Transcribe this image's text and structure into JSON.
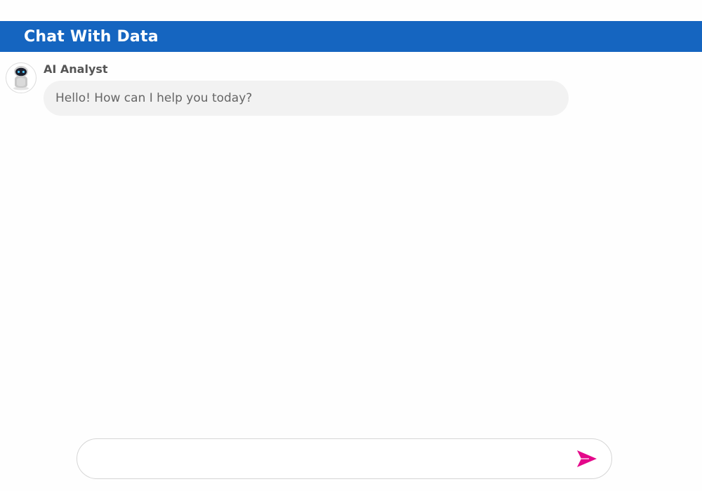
{
  "header": {
    "title": "Chat With Data"
  },
  "messages": [
    {
      "sender": "AI Analyst",
      "text": "Hello! How can I help you today?",
      "avatar_icon": "robot-icon"
    }
  ],
  "composer": {
    "placeholder": "",
    "value": "",
    "send_icon": "send-icon"
  },
  "colors": {
    "accent": "#1565c0",
    "send": "#e4088a",
    "bubble": "#f2f2f2"
  }
}
